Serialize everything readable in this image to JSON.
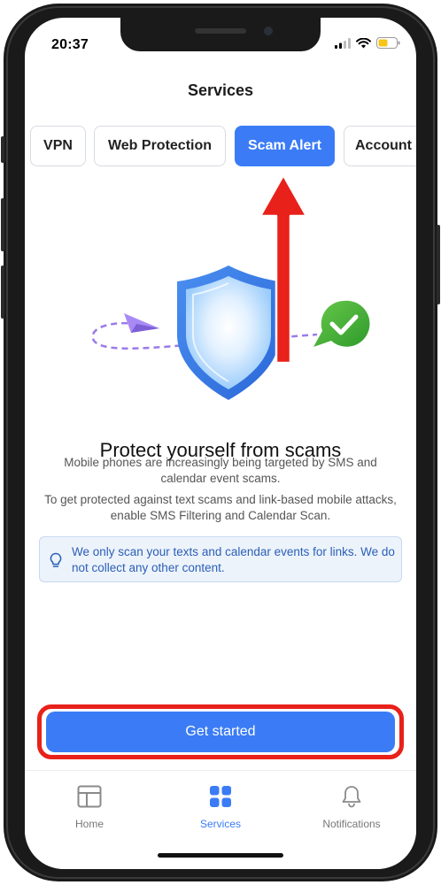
{
  "status_bar": {
    "time": "20:37"
  },
  "page": {
    "title": "Services"
  },
  "tabs": [
    {
      "label": "VPN"
    },
    {
      "label": "Web Protection"
    },
    {
      "label": "Scam Alert",
      "active": true
    },
    {
      "label": "Account"
    }
  ],
  "content": {
    "headline": "Protect yourself from scams",
    "paragraph_1": "Mobile phones are increasingly being targeted by SMS and calendar event scams.",
    "paragraph_2": "To get protected against text scams and link-based mobile attacks, enable SMS Filtering and Calendar Scan.",
    "info_text": "We only scan your texts and calendar events for links. We do not collect any other content."
  },
  "cta": {
    "label": "Get started"
  },
  "bottom_nav": [
    {
      "label": "Home",
      "icon": "home-icon"
    },
    {
      "label": "Services",
      "icon": "grid-icon",
      "active": true
    },
    {
      "label": "Notifications",
      "icon": "bell-icon"
    }
  ],
  "colors": {
    "accent": "#3b7cf6",
    "annotation": "#e8211a",
    "info_bg": "#edf3fb",
    "info_text": "#2a5fb5"
  }
}
